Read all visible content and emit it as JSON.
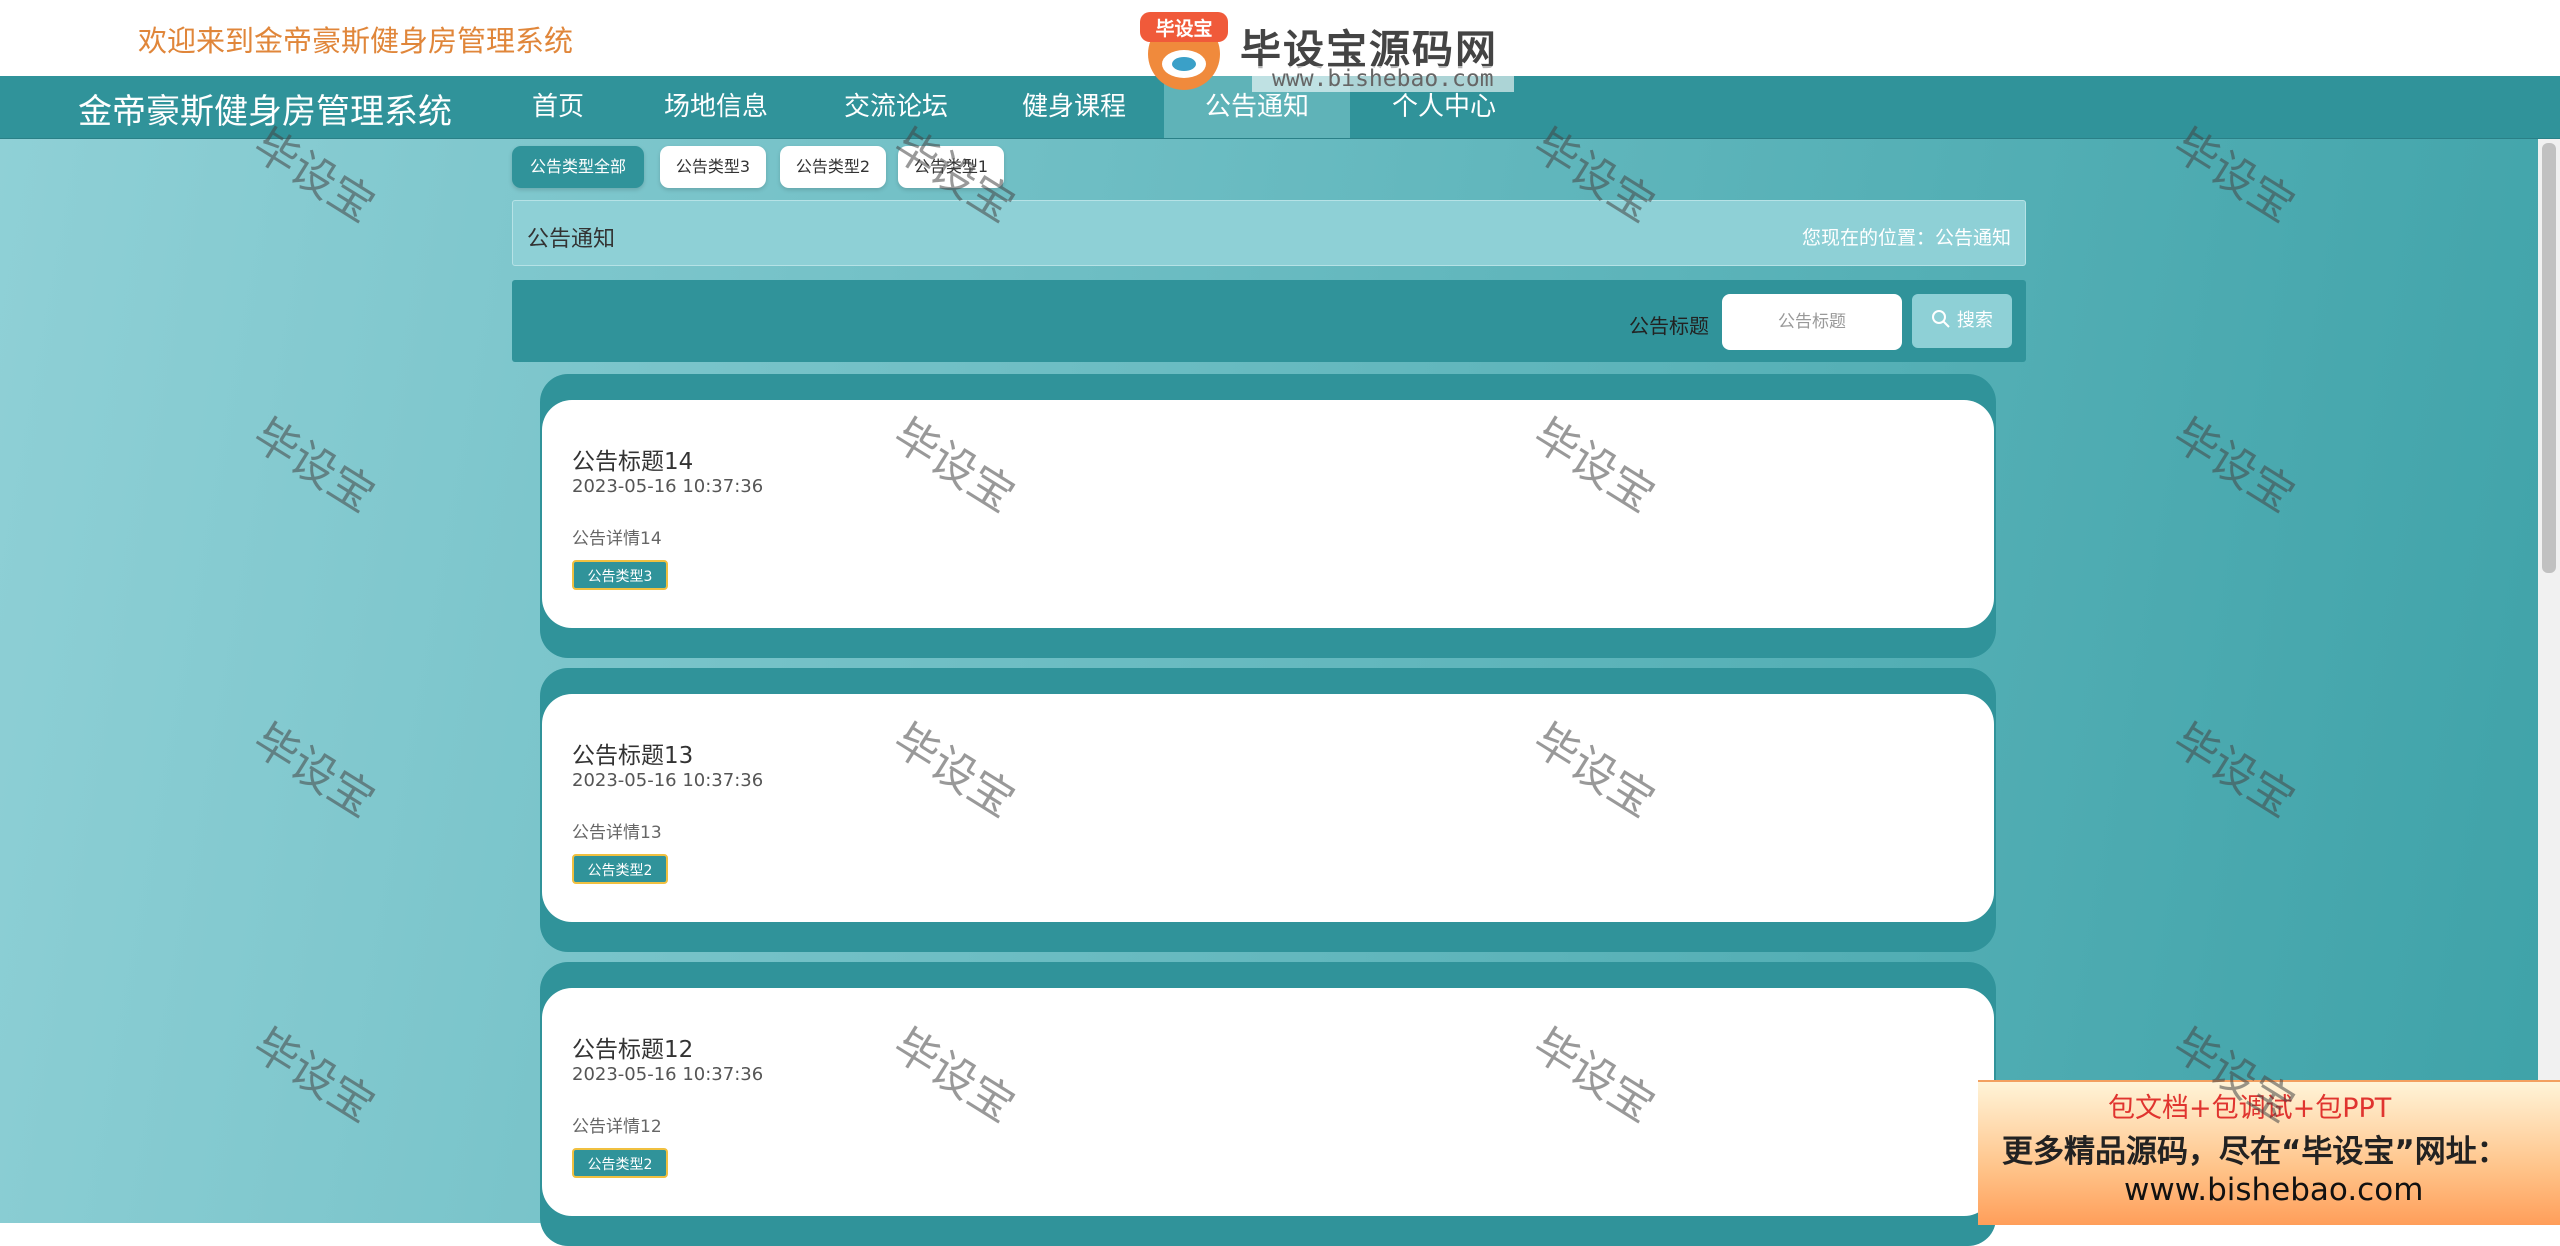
{
  "header": {
    "welcome": "欢迎来到金帝豪斯健身房管理系统",
    "logo_title": "毕设宝源码网",
    "logo_badge": "毕设宝",
    "logo_url": "www.bishebao.com"
  },
  "nav": {
    "brand": "金帝豪斯健身房管理系统",
    "items": [
      "首页",
      "场地信息",
      "交流论坛",
      "健身课程",
      "公告通知",
      "个人中心"
    ],
    "active_index": 4
  },
  "categories": [
    "公告类型全部",
    "公告类型3",
    "公告类型2",
    "公告类型1"
  ],
  "page": {
    "title": "公告通知",
    "location": "您现在的位置：公告通知"
  },
  "search": {
    "label": "公告标题",
    "placeholder": "公告标题",
    "button": "搜索"
  },
  "notices": [
    {
      "title": "公告标题14",
      "time": "2023-05-16 10:37:36",
      "detail": "公告详情14",
      "tag": "公告类型3"
    },
    {
      "title": "公告标题13",
      "time": "2023-05-16 10:37:36",
      "detail": "公告详情13",
      "tag": "公告类型2"
    },
    {
      "title": "公告标题12",
      "time": "2023-05-16 10:37:36",
      "detail": "公告详情12",
      "tag": "公告类型2"
    }
  ],
  "watermark": "毕设宝",
  "promo": {
    "line1": "包文档+包调试+包PPT",
    "line2": "更多精品源码，尽在“毕设宝”网址：",
    "line3": "www.bishebao.com"
  },
  "colors": {
    "primary": "#30939a",
    "light": "#8ed0d6",
    "welcome": "#e0863a",
    "promo_red": "#e0342f"
  }
}
